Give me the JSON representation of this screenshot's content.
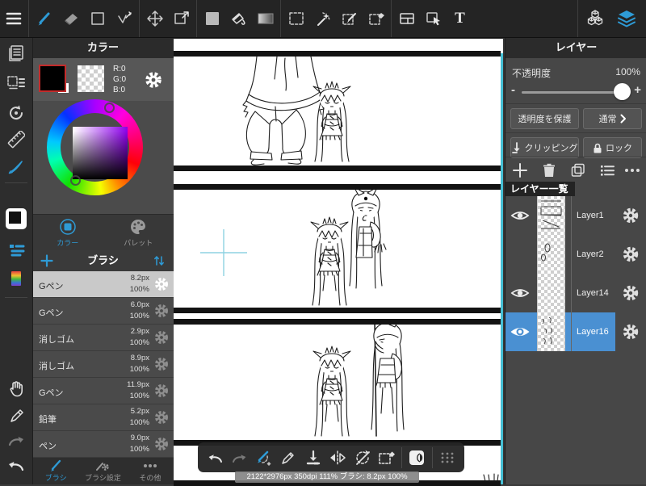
{
  "topbar": {
    "text_tool": "T"
  },
  "color_panel": {
    "title": "カラー",
    "r": "R:0",
    "g": "G:0",
    "b": "B:0",
    "tab_color": "カラー",
    "tab_palette": "パレット"
  },
  "brush_panel": {
    "title": "ブラシ",
    "brushes": [
      {
        "name": "Gペン",
        "size": "8.2px",
        "opacity": "100%",
        "selected": true
      },
      {
        "name": "Gペン",
        "size": "6.0px",
        "opacity": "100%",
        "selected": false
      },
      {
        "name": "消しゴム",
        "size": "2.9px",
        "opacity": "100%",
        "selected": false
      },
      {
        "name": "消しゴム",
        "size": "8.9px",
        "opacity": "100%",
        "selected": false
      },
      {
        "name": "Gペン",
        "size": "11.9px",
        "opacity": "100%",
        "selected": false
      },
      {
        "name": "鉛筆",
        "size": "5.2px",
        "opacity": "100%",
        "selected": false
      },
      {
        "name": "ペン",
        "size": "9.0px",
        "opacity": "100%",
        "selected": false
      }
    ],
    "tab_brush": "ブラシ",
    "tab_brush_settings": "ブラシ設定",
    "tab_others": "その他"
  },
  "layer_panel": {
    "title": "レイヤー",
    "opacity_label": "不透明度",
    "opacity_value": "100%",
    "minus": "-",
    "plus": "+",
    "protect_label": "透明度を保護",
    "blend_label": "通常",
    "clipping_label": "クリッピング",
    "lock_label": "ロック",
    "list_title": "レイヤー一覧",
    "layers": [
      {
        "name": "Layer1",
        "visible": true,
        "selected": false
      },
      {
        "name": "Layer2",
        "visible": false,
        "selected": false
      },
      {
        "name": "Layer14",
        "visible": true,
        "selected": false
      },
      {
        "name": "Layer16",
        "visible": true,
        "selected": true
      }
    ]
  },
  "statusbar": {
    "info": "2122*2976px 350dpi 111% ブラシ: 8.2px 100%"
  },
  "colors": {
    "accent": "#2E9BD6",
    "layer_selected": "#4A90D2",
    "swatch_selected_border": "#C42B2B",
    "canvas_edge_guide": "#45BFD4",
    "current_color_rgb": "0,0,0"
  }
}
